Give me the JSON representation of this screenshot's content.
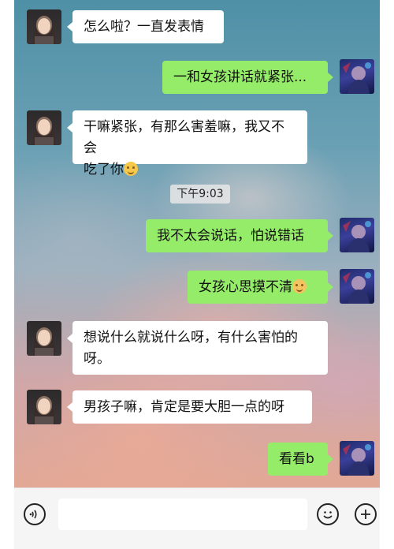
{
  "colors": {
    "sent_bubble": "#95ec69",
    "received_bubble": "#ffffff",
    "input_bar": "#f5f5f5"
  },
  "messages": [
    {
      "side": "left",
      "lines": [
        "怎么啦？一直发表情"
      ]
    },
    {
      "side": "right",
      "lines": [
        "一和女孩讲话就紧张..."
      ]
    },
    {
      "side": "left",
      "lines": [
        "干嘛紧张，有那么害羞嘛，我又不会",
        "吃了你"
      ],
      "emoji": "grin-sweat-emoji"
    },
    {
      "side": "right",
      "lines": [
        "我不太会说话，怕说错话"
      ]
    },
    {
      "side": "right",
      "lines": [
        "女孩心思摸不清"
      ],
      "emoji": "worried-emoji"
    },
    {
      "side": "left",
      "lines": [
        "想说什么就说什么呀，有什么害怕的",
        "呀。"
      ]
    },
    {
      "side": "left",
      "lines": [
        "男孩子嘛，肯定是要大胆一点的呀"
      ]
    },
    {
      "side": "right",
      "lines": [
        "看看b"
      ]
    }
  ],
  "timestamp": "下午9:03",
  "input_bar": {
    "voice_icon": "voice-icon",
    "emoji_icon": "emoji-icon",
    "add_icon": "plus-icon",
    "input_value": ""
  }
}
